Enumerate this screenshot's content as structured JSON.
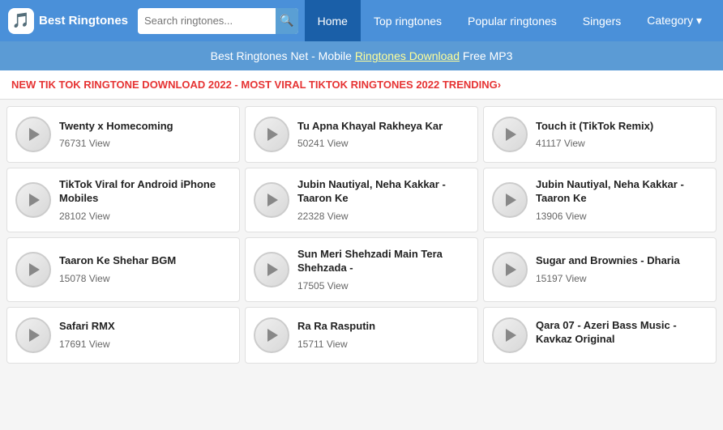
{
  "header": {
    "logo_icon": "🎵",
    "logo_text": "Best Ringtones",
    "search_placeholder": "Search ringtones...",
    "search_icon": "🔍",
    "nav": [
      {
        "label": "Home",
        "active": true
      },
      {
        "label": "Top ringtones",
        "active": false
      },
      {
        "label": "Popular ringtones",
        "active": false
      },
      {
        "label": "Singers",
        "active": false
      },
      {
        "label": "Category ▾",
        "active": false
      }
    ]
  },
  "banner": {
    "text_before": "Best Ringtones Net - Mobile ",
    "link_text": "Ringtones Download",
    "text_after": " Free MP3"
  },
  "trending": {
    "text": "NEW TIK TOK RINGTONE DOWNLOAD 2022 - MOST VIRAL TIKTOK RINGTONES 2022 TRENDING›"
  },
  "cards": [
    {
      "title": "Twenty x Homecoming",
      "views": "76731 View"
    },
    {
      "title": "Tu Apna Khayal Rakheya Kar",
      "views": "50241 View"
    },
    {
      "title": "Touch it (TikTok Remix)",
      "views": "41117 View"
    },
    {
      "title": "TikTok Viral for Android iPhone Mobiles",
      "views": "28102 View"
    },
    {
      "title": "Jubin Nautiyal, Neha Kakkar - Taaron Ke",
      "views": "22328 View"
    },
    {
      "title": "Jubin Nautiyal, Neha Kakkar - Taaron Ke",
      "views": "13906 View"
    },
    {
      "title": "Taaron Ke Shehar BGM",
      "views": "15078 View"
    },
    {
      "title": "Sun Meri Shehzadi Main Tera Shehzada -",
      "views": "17505 View"
    },
    {
      "title": "Sugar and Brownies - Dharia",
      "views": "15197 View"
    },
    {
      "title": "Safari RMX",
      "views": "17691 View"
    },
    {
      "title": "Ra Ra Rasputin",
      "views": "15711 View"
    },
    {
      "title": "Qara 07 - Azeri Bass Music - Kavkaz Original",
      "views": ""
    }
  ]
}
